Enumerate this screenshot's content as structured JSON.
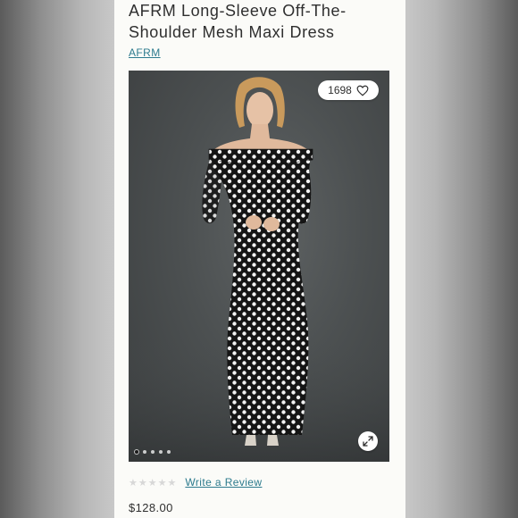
{
  "product": {
    "title": "AFRM Long-Sleeve Off-The-Shoulder Mesh Maxi Dress",
    "brand": "AFRM",
    "like_count": "1698",
    "rating_stars": 0,
    "review_link": "Write a Review",
    "price": "$128.00"
  },
  "carousel": {
    "total_images": 5,
    "active_index": 0
  },
  "icons": {
    "like": "heart-icon",
    "expand": "expand-arrows-icon",
    "star": "star-icon"
  },
  "colors": {
    "link": "#2d7b8e",
    "text": "#2f2f2f",
    "star_empty": "#d7d7d7",
    "panel_bg": "#fbfbf8"
  }
}
